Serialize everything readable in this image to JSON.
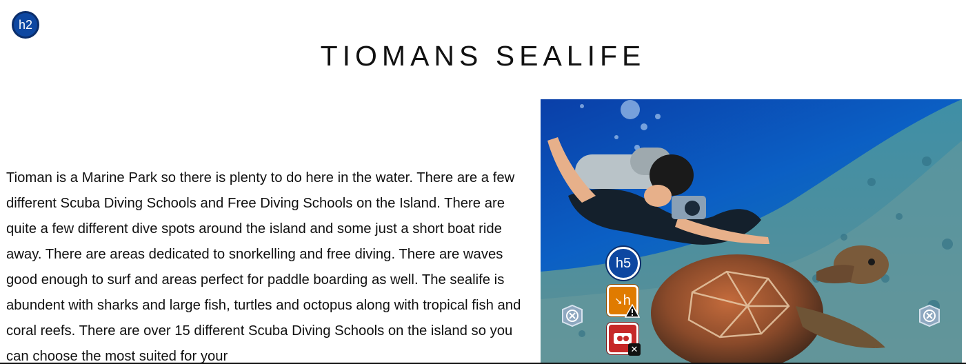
{
  "badges": {
    "top_left": "h2",
    "image_overlay": "h5",
    "orange_tool": "h"
  },
  "page": {
    "title": "TIOMANS SEALIFE",
    "body": "Tioman is a Marine Park so there is plenty to do here in the water. There are a few different Scuba Diving Schools and Free Diving Schools on the Island. There are quite a few different dive spots around the island and some just a short boat ride away. There are areas dedicated to snorkelling and free diving. There are waves good enough to surf and areas perfect for paddle boarding as well. The sealife is abundent with sharks and large fish, turtles and octopus along with tropical fish and coral reefs. There are over 15 different Scuba Diving Schools on the island so you can choose the most suited for your"
  },
  "icons": {
    "badge": "heading-level-badge-icon",
    "orange": "redirect-icon",
    "warning": "warning-triangle-icon",
    "red": "video-icon",
    "close": "close-icon",
    "nav": "shield-close-icon"
  },
  "colors": {
    "badge_blue": "#0d47a1",
    "tool_orange": "#e07b00",
    "tool_red": "#c62828",
    "text": "#111111"
  }
}
